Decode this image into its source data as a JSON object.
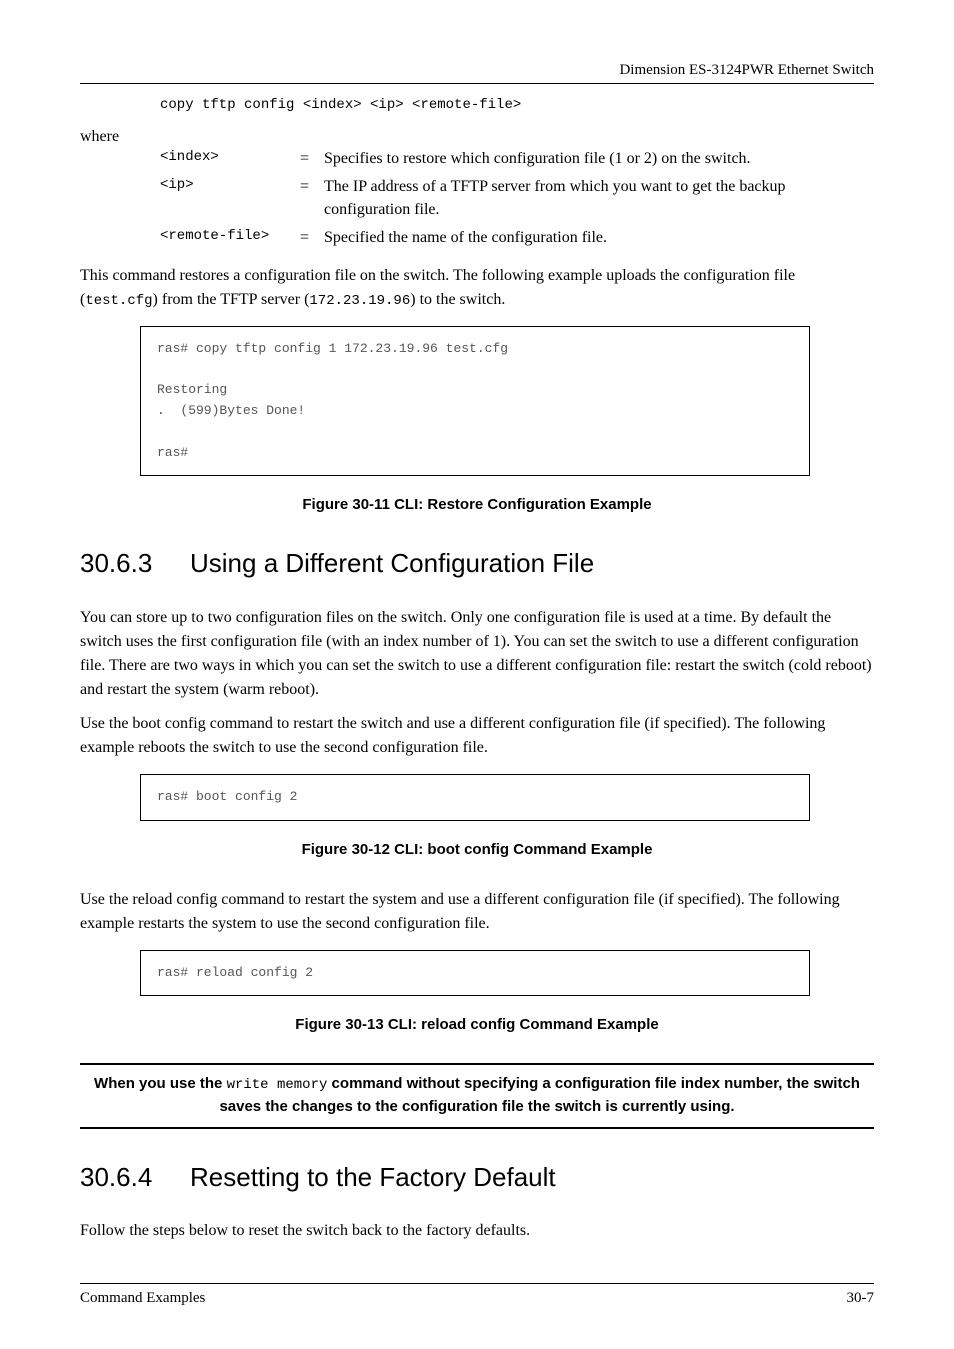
{
  "header": {
    "title": "Dimension ES-3124PWR Ethernet Switch"
  },
  "cmd_syntax": "copy tftp config <index> <ip> <remote-file>",
  "where_label": "where",
  "defs": [
    {
      "term": "<index>",
      "eq": "=",
      "desc": "Specifies to restore which configuration file (1 or 2) on the switch."
    },
    {
      "term": "<ip>",
      "eq": "=",
      "desc": "The IP address of a TFTP server from which you want to get the backup configuration file."
    },
    {
      "term": "<remote-file>",
      "eq": "=",
      "desc": "Specified the name of the configuration file."
    }
  ],
  "para_restore_1": "This command restores a configuration file on the switch. The following example uploads the configuration file (",
  "para_restore_code1": "test.cfg",
  "para_restore_2": ") from the TFTP server (",
  "para_restore_code2": "172.23.19.96",
  "para_restore_3": ") to the switch.",
  "codebox1": "ras# copy tftp config 1 172.23.19.96 test.cfg\n\nRestoring\n.  (599)Bytes Done!\n\nras#",
  "fig1": "Figure 30-11 CLI: Restore Configuration Example",
  "sec_3063_num": "30.6.3",
  "sec_3063_title": "Using a Different Configuration File",
  "para_3063_a": "You can store up to two configuration files on the switch. Only one configuration file is used at a time. By default the switch uses the first configuration file (with an index number of 1). You can set the switch to use a different configuration file. There are two ways in which you can set the switch to use a different configuration file: restart the switch (cold reboot) and restart the system (warm reboot).",
  "para_3063_b": "Use the boot config command to restart the switch and use a different configuration file (if specified). The following example reboots the switch to use the second configuration file.",
  "codebox2": "ras# boot config 2",
  "fig2": "Figure 30-12 CLI: boot config Command Example",
  "para_3063_c": "Use the reload config command to restart the system and use a different configuration file (if specified). The following example restarts the system to use the second configuration file.",
  "codebox3": "ras# reload config 2",
  "fig3": "Figure 30-13 CLI: reload config Command Example",
  "note_pre": "When you use the ",
  "note_code": "write memory",
  "note_post": " command without specifying a configuration file index number, the switch saves the changes to the configuration file the switch is currently using.",
  "sec_3064_num": "30.6.4",
  "sec_3064_title": "Resetting to the Factory Default",
  "para_3064": "Follow the steps below to reset the switch back to the factory defaults.",
  "footer": {
    "left": "Command Examples",
    "right": "30-7"
  }
}
